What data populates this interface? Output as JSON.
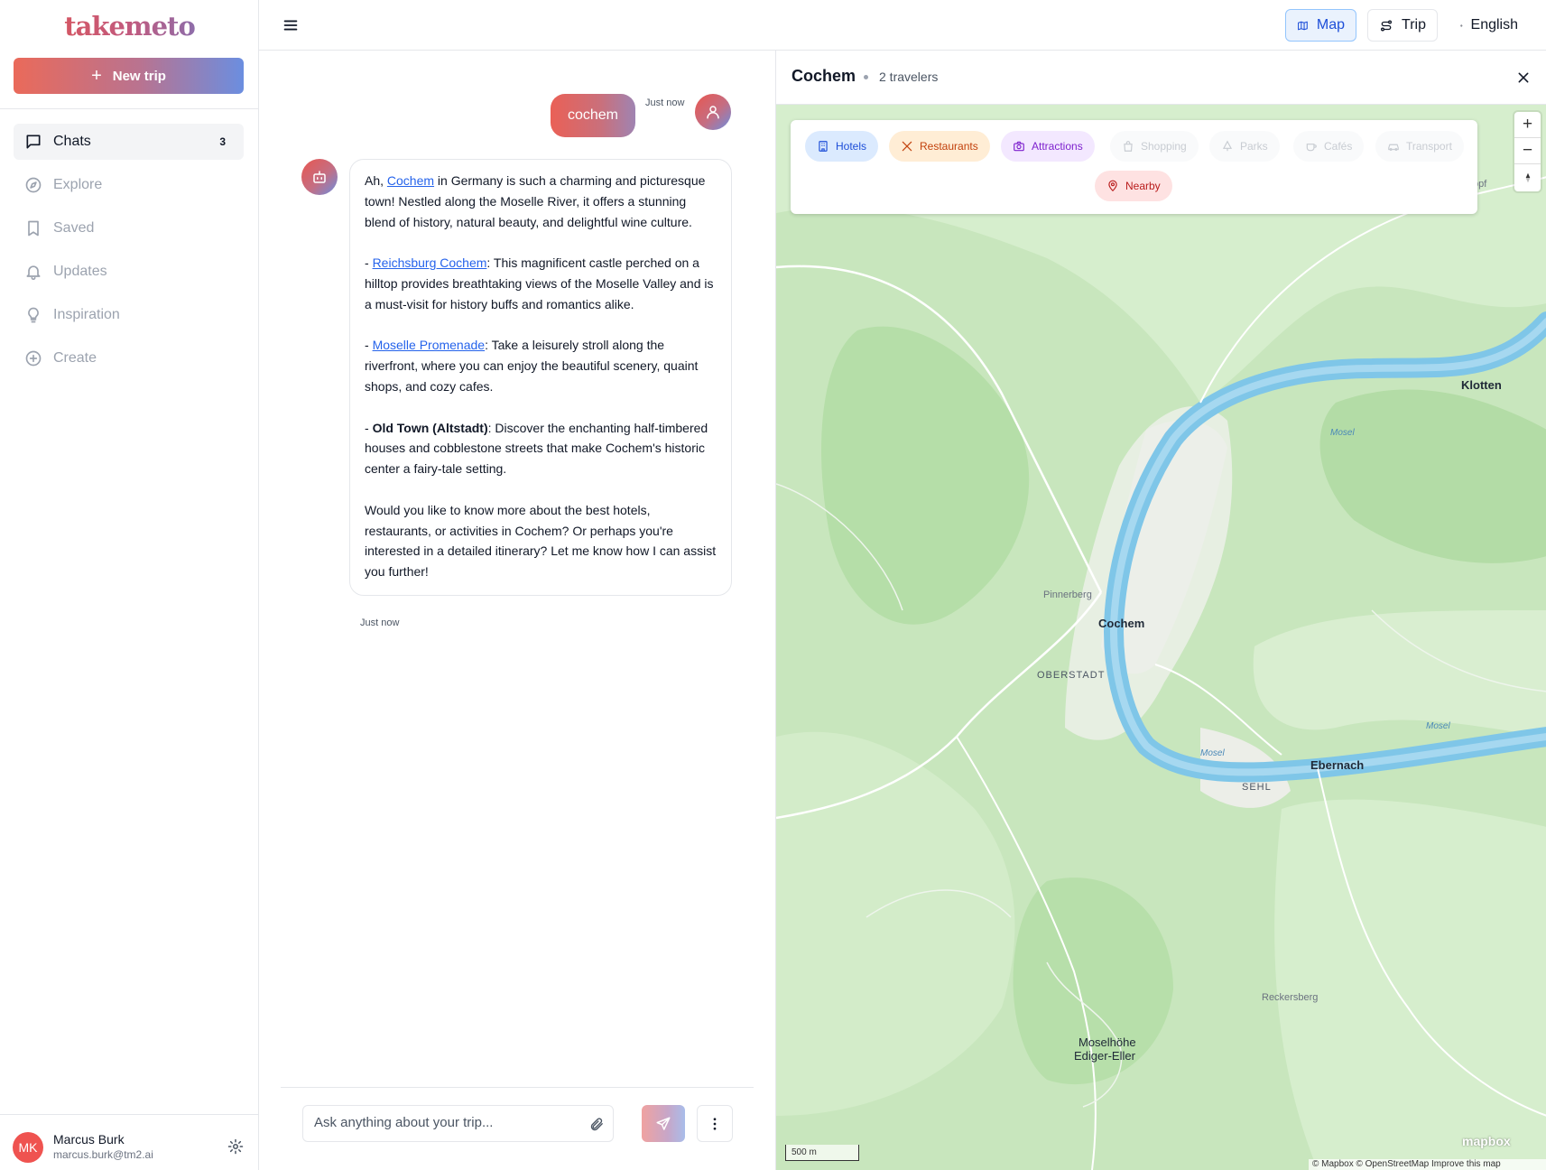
{
  "app": {
    "logo": "takemeto"
  },
  "sidebar": {
    "new_trip_label": "New trip",
    "items": [
      {
        "label": "Chats",
        "icon": "chat-bubble-icon",
        "badge": "3",
        "active": true
      },
      {
        "label": "Explore",
        "icon": "compass-icon"
      },
      {
        "label": "Saved",
        "icon": "bookmark-icon"
      },
      {
        "label": "Updates",
        "icon": "bell-icon"
      },
      {
        "label": "Inspiration",
        "icon": "lightbulb-icon"
      },
      {
        "label": "Create",
        "icon": "plus-circle-icon"
      }
    ],
    "user": {
      "initials": "MK",
      "name": "Marcus Burk",
      "email": "marcus.burk@tm2.ai"
    }
  },
  "topbar": {
    "map_label": "Map",
    "trip_label": "Trip",
    "language_label": "English"
  },
  "chat": {
    "user_message": "cochem",
    "user_time": "Just now",
    "bot_time": "Just now",
    "bot": {
      "p1_prefix": "Ah, ",
      "p1_link": "Cochem",
      "p1_rest": " in Germany is such a charming and picturesque town! Nestled along the Moselle River, it offers a stunning blend of history, natural beauty, and delightful wine culture.",
      "p2_dash": "- ",
      "p2_link": "Reichsburg Cochem",
      "p2_rest": ": This magnificent castle perched on a hilltop provides breathtaking views of the Moselle Valley and is a must-visit for history buffs and romantics alike.",
      "p3_dash": "- ",
      "p3_link": "Moselle Promenade",
      "p3_rest": ": Take a leisurely stroll along the riverfront, where you can enjoy the beautiful scenery, quaint shops, and cozy cafes.",
      "p4_dash": "- ",
      "p4_bold": "Old Town (Altstadt)",
      "p4_rest": ": Discover the enchanting half-timbered houses and cobblestone streets that make Cochem's historic center a fairy-tale setting.",
      "p5": "Would you like to know more about the best hotels, restaurants, or activities in Cochem? Or perhaps you're interested in a detailed itinerary? Let me know how I can assist you further!"
    },
    "input_placeholder": "Ask anything about your trip..."
  },
  "map": {
    "title": "Cochem",
    "travelers": "2 travelers",
    "categories": {
      "hotels": "Hotels",
      "restaurants": "Restaurants",
      "attractions": "Attractions",
      "shopping": "Shopping",
      "parks": "Parks",
      "cafes": "Cafés",
      "transport": "Transport",
      "nearby": "Nearby"
    },
    "places": {
      "klotten": "Klotten",
      "cochem": "Cochem",
      "oberstadt": "OBERSTADT",
      "pinnerberg": "Pinnerberg",
      "ebernach": "Ebernach",
      "sehl": "SEHL",
      "reckersberg": "Reckersberg",
      "moselhoehe": "Moselhöhe",
      "ediger": "Ediger-Eller",
      "opf": "opf"
    },
    "river": "Mosel",
    "scale": "500 m",
    "attribution": "© Mapbox © OpenStreetMap  Improve this map",
    "logo": "mapbox",
    "colors": {
      "water": "#7fc6e8",
      "forest": "#bfe3b4",
      "land": "#e8f1e2"
    }
  }
}
